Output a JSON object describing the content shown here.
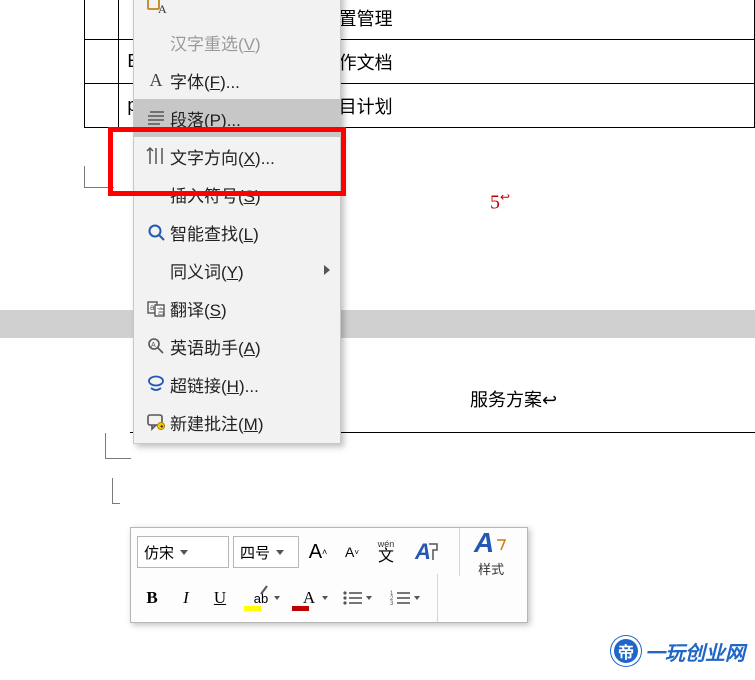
{
  "table": {
    "rows": [
      {
        "c2": "",
        "c3": "配置管理"
      },
      {
        "c2": "Excel↩",
        "c3": "制作文档"
      },
      {
        "c2": "project↩",
        "c3": "项目计划"
      }
    ]
  },
  "page_number": "5",
  "doc_text2": "服务方案↩",
  "context_menu": {
    "items": [
      {
        "key": "paste-special",
        "label": "",
        "short": "",
        "icon": "clipboard-a-icon",
        "disabled": false
      },
      {
        "key": "cjk-reselect",
        "label": "汉字重选",
        "short": "V",
        "icon": "",
        "disabled": true
      },
      {
        "key": "font",
        "label": "字体",
        "short": "F",
        "icon": "font-icon",
        "disabled": false
      },
      {
        "key": "paragraph",
        "label": "段落",
        "short": "P",
        "suffix": "...",
        "icon": "paragraph-icon",
        "disabled": false,
        "hover": true
      },
      {
        "key": "text-direction",
        "label": "文字方向",
        "short": "X",
        "suffix": "...",
        "icon": "text-direction-icon",
        "disabled": false
      },
      {
        "key": "insert-symbol",
        "label": "插入符号",
        "short": "S",
        "icon": "",
        "disabled": false
      },
      {
        "key": "smart-lookup",
        "label": "智能查找",
        "short": "L",
        "icon": "search-icon",
        "disabled": false
      },
      {
        "key": "synonyms",
        "label": "同义词",
        "short": "Y",
        "icon": "",
        "disabled": false,
        "submenu": true
      },
      {
        "key": "translate",
        "label": "翻译",
        "short": "S",
        "icon": "translate-icon",
        "disabled": false
      },
      {
        "key": "english-assist",
        "label": "英语助手",
        "short": "A",
        "icon": "english-assist-icon",
        "disabled": false
      },
      {
        "key": "hyperlink",
        "label": "超链接",
        "short": "H",
        "suffix": "...",
        "icon": "link-icon",
        "disabled": false
      },
      {
        "key": "new-comment",
        "label": "新建批注",
        "short": "M",
        "icon": "new-comment-icon",
        "disabled": false
      }
    ]
  },
  "mini_toolbar": {
    "font_name": "仿宋",
    "font_size": "四号",
    "grow_font": "A",
    "shrink_font": "A",
    "phonetic_pinyin": "wén",
    "phonetic_hanzi": "文",
    "format_painter": "A",
    "bold": "B",
    "italic": "I",
    "underline": "U",
    "highlight_glyph": "ab",
    "font_color_glyph": "A",
    "styles_label": "样式",
    "styles_glyph": "A"
  },
  "watermark": {
    "badge": "帝",
    "text": "一玩创业网"
  }
}
